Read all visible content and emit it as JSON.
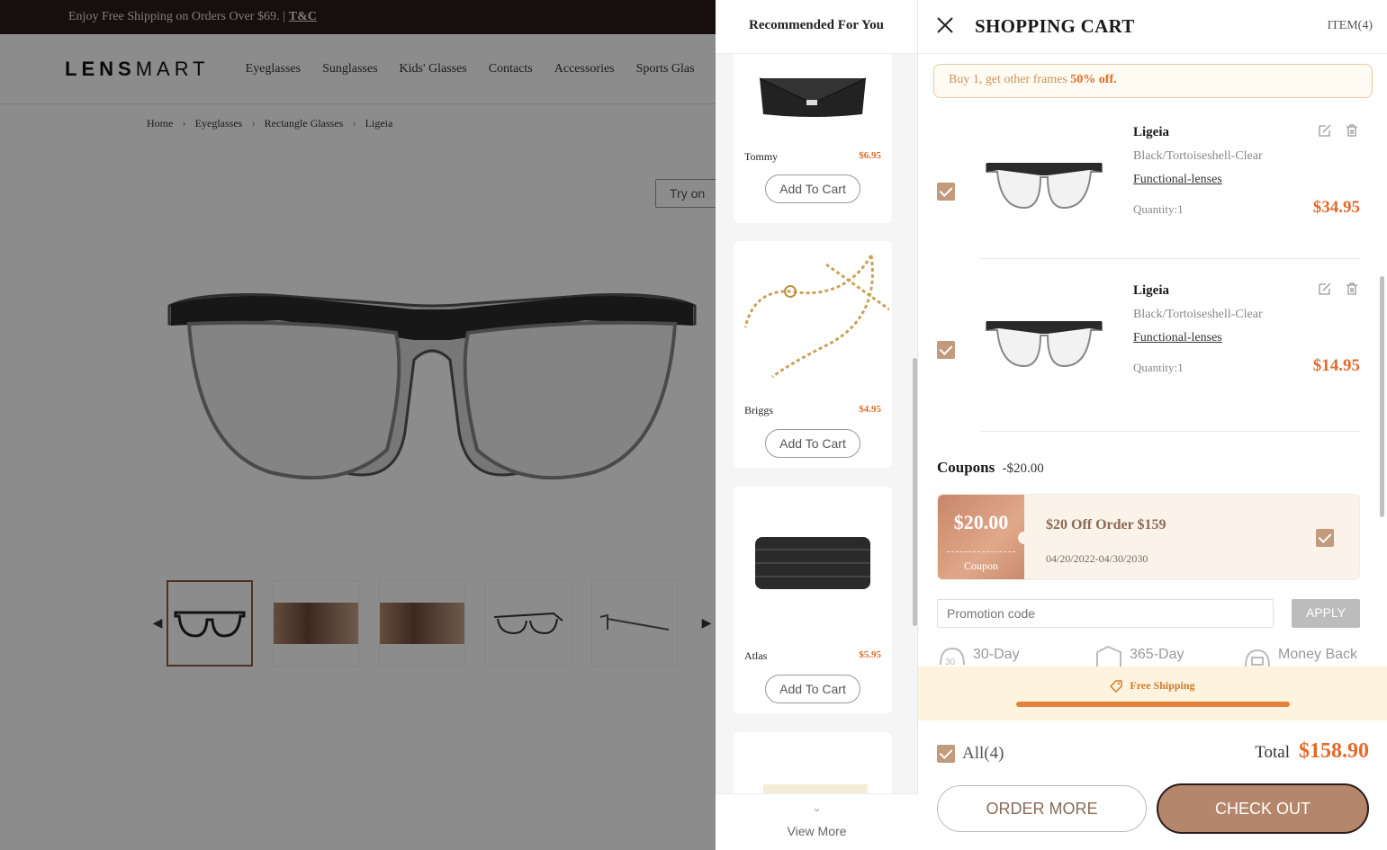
{
  "background_page": {
    "promo_text": "Enjoy Free Shipping on Orders Over $69. |",
    "promo_link": "T&C",
    "logo_bold": "LENS",
    "logo_light": "MART",
    "nav": [
      "Eyeglasses",
      "Sunglasses",
      "Kids' Glasses",
      "Contacts",
      "Accessories",
      "Sports Glas"
    ],
    "breadcrumb": [
      "Home",
      "Eyeglasses",
      "Rectangle Glasses",
      "Ligeia"
    ],
    "try_on_label": "Try on"
  },
  "recommended": {
    "title": "Recommended For You",
    "add_label": "Add To Cart",
    "items": [
      {
        "name": "Tommy",
        "price": "$6.95"
      },
      {
        "name": "Briggs",
        "price": "$4.95"
      },
      {
        "name": "Atlas",
        "price": "$5.95"
      }
    ],
    "view_more": "View More"
  },
  "cart": {
    "title": "SHOPPING CART",
    "count": "ITEM(4)",
    "promo_prefix": "Buy 1, get other frames",
    "promo_highlight": "50% off.",
    "items": [
      {
        "name": "Ligeia",
        "color": "Black/Tortoiseshell-Clear",
        "lens": "Functional-lenses",
        "quantity": "Quantity:1",
        "price": "$34.95"
      },
      {
        "name": "Ligeia",
        "color": "Black/Tortoiseshell-Clear",
        "lens": "Functional-lenses",
        "quantity": "Quantity:1",
        "price": "$14.95"
      }
    ],
    "coupons_label": "Coupons",
    "coupons_discount": "-$20.00",
    "coupon": {
      "amount": "$20.00",
      "stub_label": "Coupon",
      "title": "$20 Off Order $159",
      "date": "04/20/2022-04/30/2030"
    },
    "promo_placeholder": "Promotion code",
    "apply_label": "APPLY",
    "perks": [
      "30-Day",
      "365-Day",
      "Money Back"
    ],
    "shipping_label": "Free Shipping",
    "shipping_progress": 1.0,
    "all_label": "All(4)",
    "total_label": "Total",
    "total_value": "$158.90",
    "order_more_label": "ORDER MORE",
    "checkout_label": "CHECK OUT"
  },
  "colors": {
    "accent": "#e36a2a",
    "brand": "#b4876c",
    "checkbox": "#c29a7c"
  }
}
